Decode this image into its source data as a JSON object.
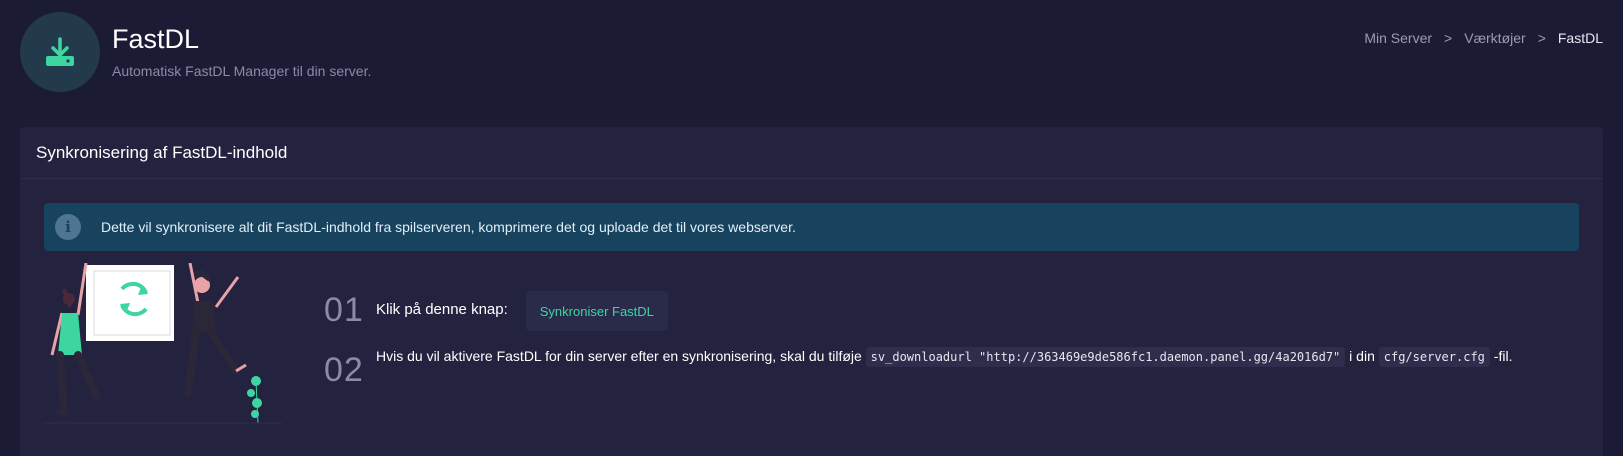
{
  "header": {
    "title": "FastDL",
    "subtitle": "Automatisk FastDL Manager til din server.",
    "icon": "download-icon"
  },
  "breadcrumb": {
    "items": [
      "Min Server",
      "Værktøjer",
      "FastDL"
    ],
    "separator": ">"
  },
  "card": {
    "title": "Synkronisering af FastDL-indhold",
    "alert": {
      "icon": "info-icon",
      "text": "Dette vil synkronisere alt dit FastDL-indhold fra spilserveren, komprimere det og uploade det til vores webserver."
    },
    "steps": [
      {
        "number": "01",
        "text": "Klik på denne knap:",
        "button_label": "Synkroniser FastDL"
      },
      {
        "number": "02",
        "text_before": "Hvis du vil aktivere FastDL for din server efter en synkronisering, skal du tilføje",
        "code_url": "sv_downloadurl \"http://363469e9de586fc1.daemon.panel.gg/4a2016d7\"",
        "text_middle": "i din",
        "code_file": "cfg/server.cfg",
        "text_after": "-fil."
      }
    ]
  },
  "colors": {
    "background": "#1c1b36",
    "card": "#23223f",
    "accent": "#3ed6a0",
    "alert_bg": "#17435f"
  }
}
